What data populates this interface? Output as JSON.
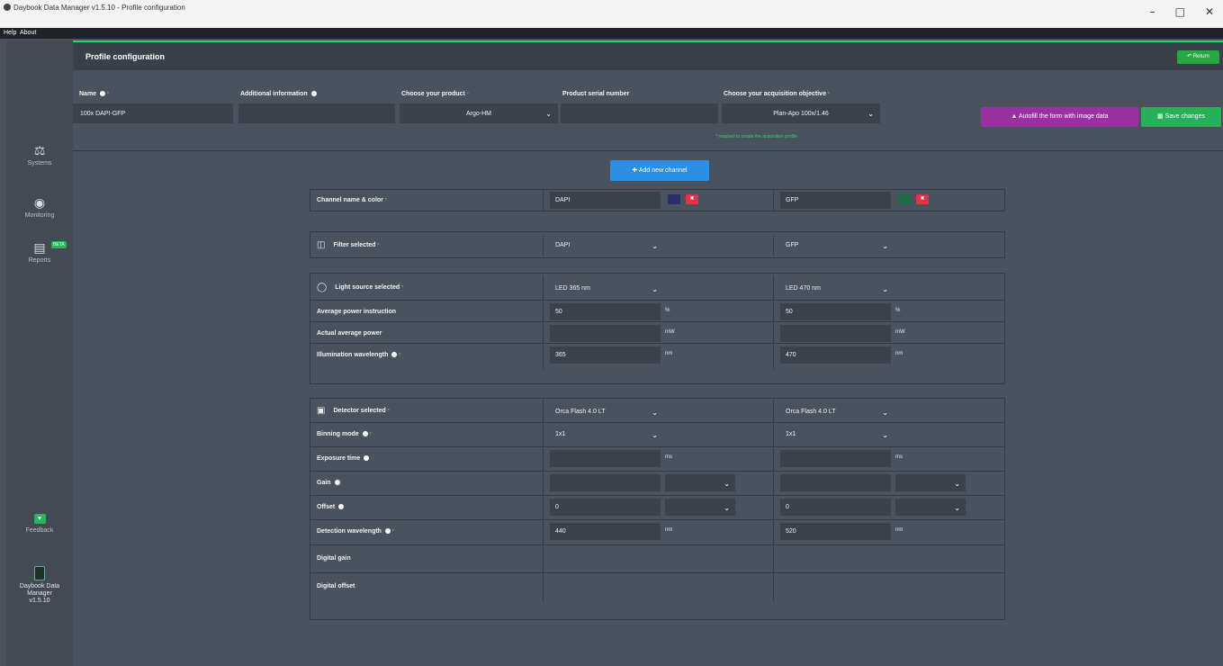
{
  "window": {
    "title": "Daybook Data Manager v1.5.10 - Profile configuration",
    "minimize": "–",
    "maximize": "□",
    "close": "✕"
  },
  "menu": {
    "help": "Help",
    "about": "About"
  },
  "sidebar": {
    "items": [
      {
        "label": "Systems",
        "icon": "microscope-icon"
      },
      {
        "label": "Monitoring",
        "icon": "gauge-icon"
      },
      {
        "label": "Reports",
        "icon": "report-icon",
        "badge": "BETA"
      },
      {
        "label": "Feedback",
        "icon": "feedback-icon"
      }
    ],
    "app_name_line1": "Daybook Data",
    "app_name_line2": "Manager",
    "app_version": "v1.5.10"
  },
  "header": {
    "title": "Profile configuration",
    "return_label": "Return"
  },
  "form": {
    "name_label": "Name",
    "name_value": "100x DAPI-GFP",
    "additional_label": "Additional information",
    "additional_value": "",
    "product_label": "Choose your product",
    "product_value": "Argo-HM",
    "serial_label": "Product serial number",
    "serial_value": "",
    "objective_label": "Choose your acquisition objective",
    "objective_value": "Plan-Apo 100x/1.46",
    "required_note": "* required to create the acquisition profile",
    "autofill_label": "Autofill the form with image data",
    "save_label": "Save changes"
  },
  "add_channel_label": "Add new channel",
  "channels": {
    "labels": {
      "channel_name": "Channel name & color",
      "filter": "Filter selected",
      "light_source": "Light source selected",
      "avg_power_instruction": "Average power instruction",
      "actual_avg_power": "Actual average power",
      "illum_wavelength": "Illumination wavelength",
      "detector": "Detector selected",
      "binning": "Binning mode",
      "exposure": "Exposure time",
      "gain": "Gain",
      "offset": "Offset",
      "detection_wavelength": "Detection wavelength",
      "digital_gain": "Digital gain",
      "digital_offset": "Digital offset"
    },
    "units": {
      "percent": "%",
      "mw": "mW",
      "nm": "nm",
      "ms": "ms"
    },
    "ch1": {
      "name": "DAPI",
      "color": "#2b2f6b",
      "filter": "DAPI",
      "light_source": "LED 365 nm",
      "avg_power": "50",
      "actual_power": "",
      "illum_wl": "365",
      "detector": "Orca Flash 4.0 LT",
      "binning": "1x1",
      "exposure": "",
      "gain": "",
      "offset": "0",
      "detection_wl": "440"
    },
    "ch2": {
      "name": "GFP",
      "color": "#1f6b4a",
      "filter": "GFP",
      "light_source": "LED 470 nm",
      "avg_power": "50",
      "actual_power": "",
      "illum_wl": "470",
      "detector": "Orca Flash 4.0 LT",
      "binning": "1x1",
      "exposure": "",
      "gain": "",
      "offset": "0",
      "detection_wl": "520"
    }
  },
  "colors": {
    "accent_green": "#28b058",
    "accent_blue": "#2b8fe3",
    "accent_purple": "#9b2fa4",
    "danger": "#dc3545"
  }
}
